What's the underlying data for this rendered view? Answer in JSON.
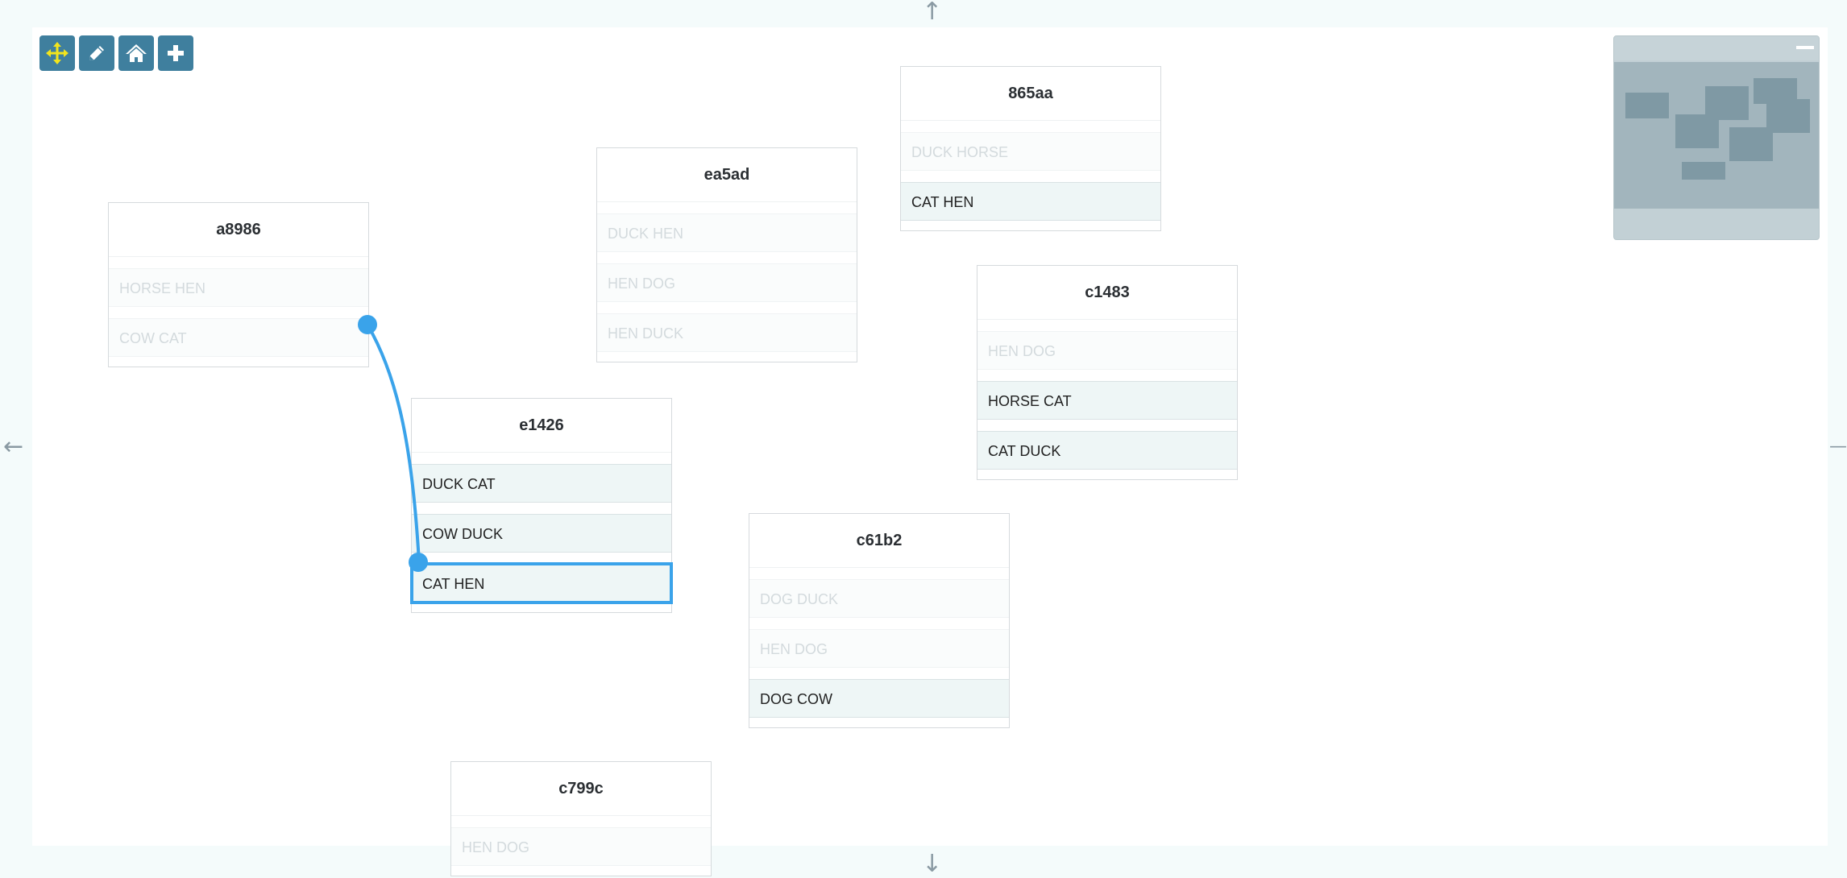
{
  "toolbar": {
    "buttons": [
      {
        "name": "move",
        "icon": "move-arrows-icon"
      },
      {
        "name": "edit",
        "icon": "pencil-icon"
      },
      {
        "name": "home",
        "icon": "home-icon"
      },
      {
        "name": "add",
        "icon": "plus-icon"
      }
    ],
    "accent": "#3f7f9e",
    "move_icon_color": "#f2e41c"
  },
  "scroll_arrows": {
    "up": "↑",
    "down": "↓",
    "left": "←",
    "right": "—"
  },
  "nodes": [
    {
      "id": "a8986",
      "title": "a8986",
      "rows": [
        {
          "label": "HORSE HEN",
          "state": "inactive"
        },
        {
          "label": "COW CAT",
          "state": "inactive"
        }
      ]
    },
    {
      "id": "ea5ad",
      "title": "ea5ad",
      "rows": [
        {
          "label": "DUCK HEN",
          "state": "inactive"
        },
        {
          "label": "HEN DOG",
          "state": "inactive"
        },
        {
          "label": "HEN DUCK",
          "state": "inactive"
        }
      ]
    },
    {
      "id": "865aa",
      "title": "865aa",
      "rows": [
        {
          "label": "DUCK HORSE",
          "state": "inactive"
        },
        {
          "label": "CAT HEN",
          "state": "active"
        }
      ]
    },
    {
      "id": "c1483",
      "title": "c1483",
      "rows": [
        {
          "label": "HEN DOG",
          "state": "inactive"
        },
        {
          "label": "HORSE CAT",
          "state": "active"
        },
        {
          "label": "CAT DUCK",
          "state": "active"
        }
      ]
    },
    {
      "id": "e1426",
      "title": "e1426",
      "rows": [
        {
          "label": "DUCK CAT",
          "state": "active"
        },
        {
          "label": "COW DUCK",
          "state": "active"
        },
        {
          "label": "CAT HEN",
          "state": "selected"
        }
      ]
    },
    {
      "id": "c61b2",
      "title": "c61b2",
      "rows": [
        {
          "label": "DOG DUCK",
          "state": "inactive"
        },
        {
          "label": "HEN DOG",
          "state": "inactive"
        },
        {
          "label": "DOG COW",
          "state": "active"
        }
      ]
    },
    {
      "id": "c799c",
      "title": "c799c",
      "rows": [
        {
          "label": "HEN DOG",
          "state": "inactive"
        }
      ]
    }
  ],
  "connection": {
    "from": "a8986.COW CAT",
    "to": "e1426.CAT HEN",
    "color": "#3aa3ea"
  },
  "minimap": {
    "minimize_icon": "minus-icon"
  }
}
